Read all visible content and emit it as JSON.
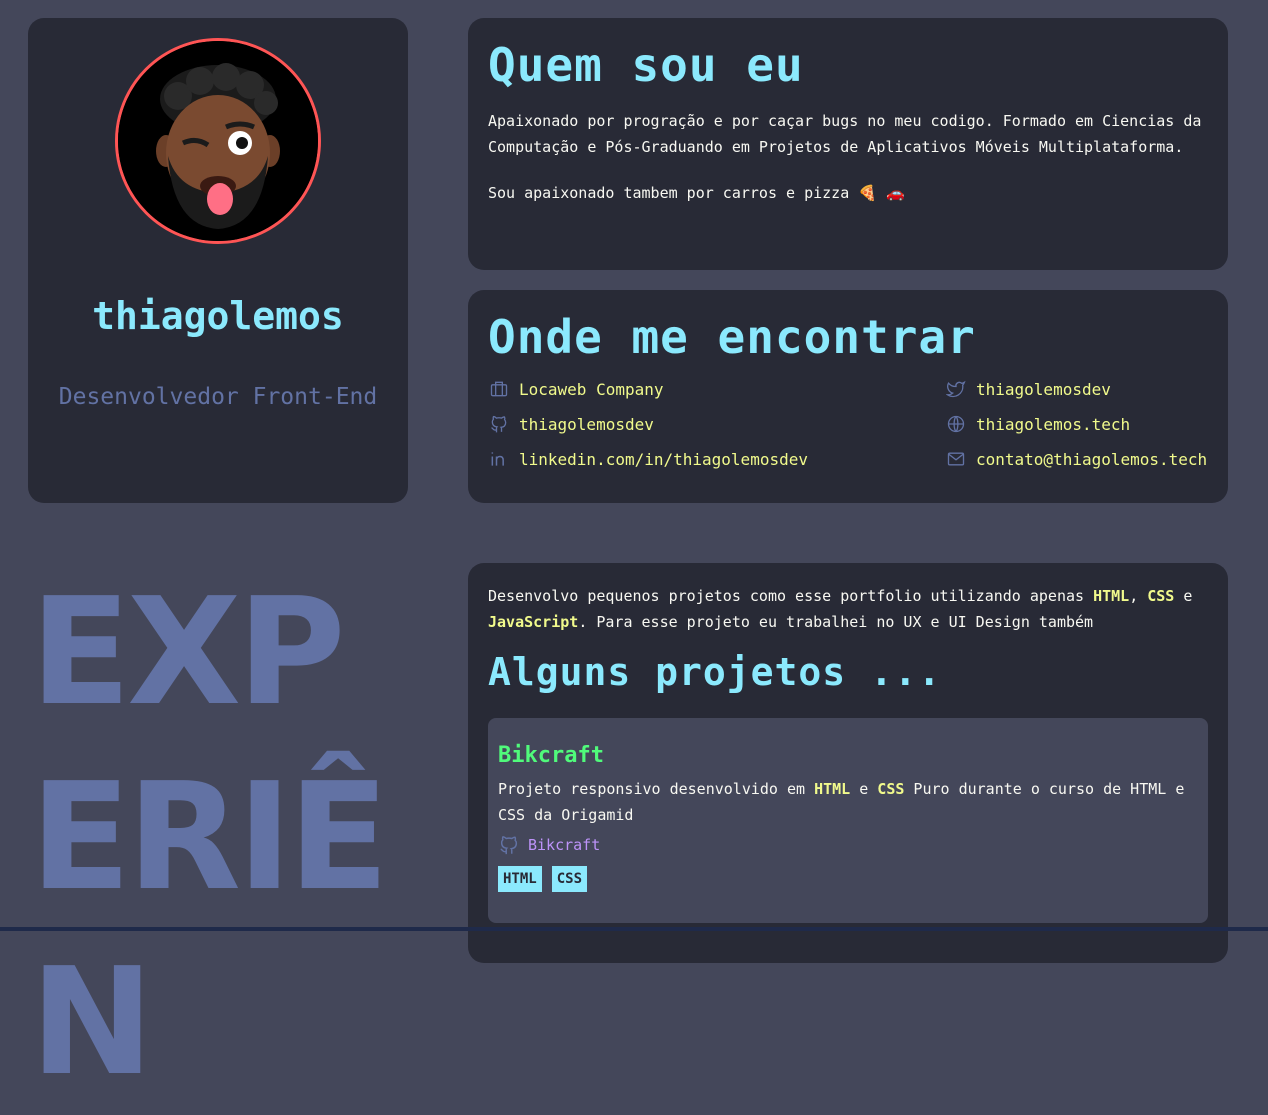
{
  "profile": {
    "username": "thiagolemos",
    "role": "Desenvolvedor Front-End"
  },
  "about": {
    "title": "Quem sou eu",
    "paragraph1": "Apaixonado por progração e por caçar bugs no meu codigo. Formado em Ciencias da Computação e Pós-Graduando em Projetos de Aplicativos Móveis Multiplataforma.",
    "paragraph2": "Sou apaixonado tambem por carros e pizza 🍕 🚗"
  },
  "contact": {
    "title": "Onde me encontrar",
    "links": [
      {
        "icon": "briefcase-icon",
        "label": "Locaweb Company"
      },
      {
        "icon": "github-icon",
        "label": "thiagolemosdev"
      },
      {
        "icon": "linkedin-icon",
        "label": "linkedin.com/in/thiagolemosdev"
      },
      {
        "icon": "twitter-icon",
        "label": "thiagolemosdev"
      },
      {
        "icon": "globe-icon",
        "label": "thiagolemos.tech"
      },
      {
        "icon": "mail-icon",
        "label": "contato@thiagolemos.tech"
      }
    ]
  },
  "experience": {
    "heading_fragment": "EXPERIÊN"
  },
  "projects": {
    "intro_before": "Desenvolvo pequenos projetos como esse portfolio utilizando apenas ",
    "intro_html": "HTML",
    "intro_comma": ", ",
    "intro_css": "CSS",
    "intro_e": " e ",
    "intro_js": "JavaScript",
    "intro_after": ". Para esse projeto eu trabalhei no UX e UI Design também",
    "title": "Alguns projetos ...",
    "items": [
      {
        "title": "Bikcraft",
        "desc_before": "Projeto responsivo desenvolvido em ",
        "desc_html": "HTML",
        "desc_e": " e ",
        "desc_css": "CSS",
        "desc_after": " Puro durante o curso de HTML e CSS da Origamid",
        "link_label": "Bikcraft",
        "tags": [
          "HTML",
          "CSS"
        ]
      }
    ]
  },
  "colors": {
    "background": "#44475a",
    "card": "#282a36",
    "cyan": "#8be9fd",
    "yellow": "#f1fa8c",
    "green": "#50fa7b",
    "purple": "#bd93f9",
    "comment": "#6272a4",
    "red": "#ff5555"
  }
}
